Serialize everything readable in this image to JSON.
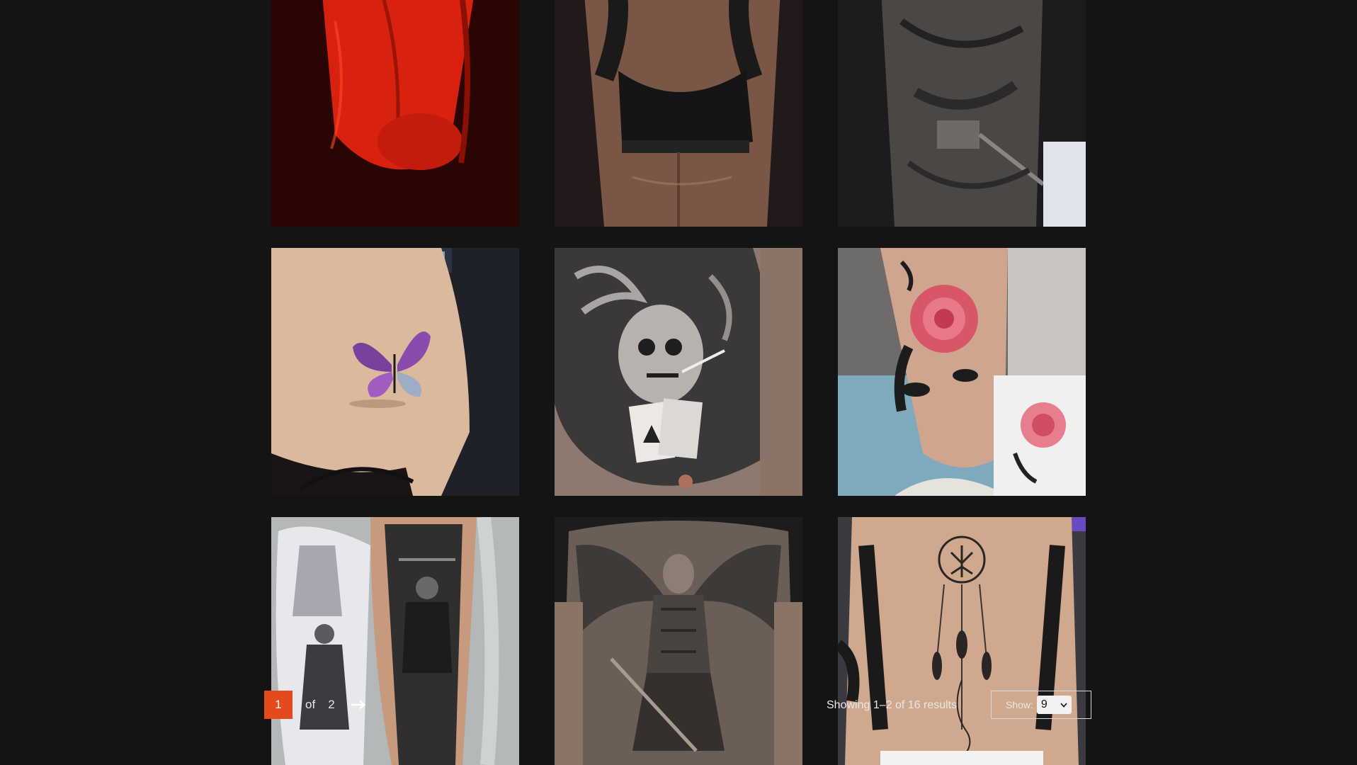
{
  "gallery": {
    "items": [
      {
        "name": "tattoo-photo-red-torso"
      },
      {
        "name": "tattoo-photo-sports-bra-back"
      },
      {
        "name": "tattoo-photo-warrior-arm"
      },
      {
        "name": "tattoo-photo-butterfly-shoulder"
      },
      {
        "name": "tattoo-photo-skull-cards-chest"
      },
      {
        "name": "tattoo-photo-rose-calf"
      },
      {
        "name": "tattoo-photo-viking-forearm"
      },
      {
        "name": "tattoo-photo-angel-backpiece"
      },
      {
        "name": "tattoo-photo-dreamcatcher-spine"
      }
    ]
  },
  "pagination": {
    "current_page": "1",
    "of_label": "of",
    "total_pages": "2",
    "next_icon": "arrow-right-icon"
  },
  "results": {
    "text": "Showing 1–2 of 16 results"
  },
  "show": {
    "label": "Show:",
    "selected": "9",
    "icon": "chevron-down-icon"
  },
  "colors": {
    "background": "#141414",
    "accent": "#e34a1d"
  }
}
